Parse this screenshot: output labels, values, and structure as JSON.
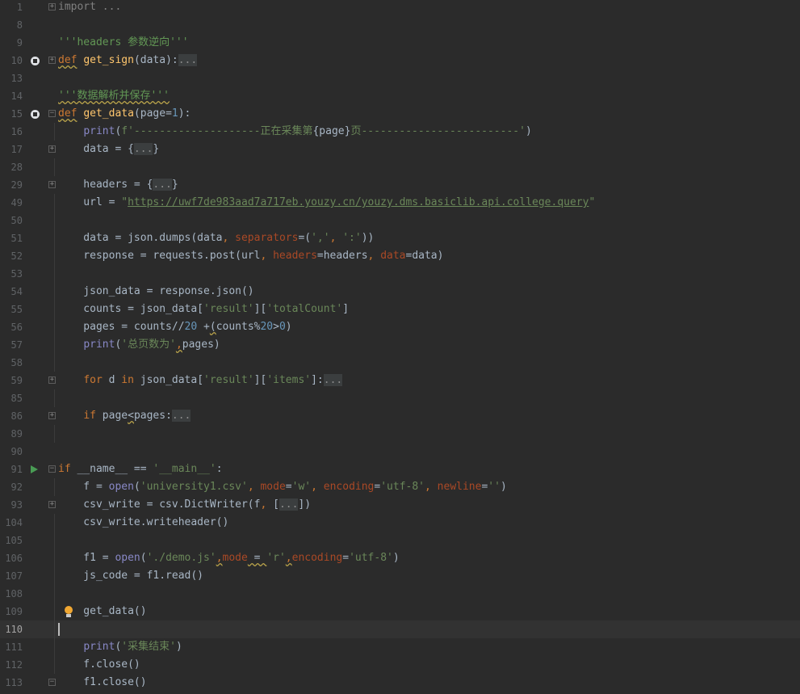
{
  "colors": {
    "background": "#2b2b2b",
    "keyword": "#cc7832",
    "function": "#ffc66d",
    "string": "#6a8759",
    "number": "#6897bb",
    "builtin": "#8888c6",
    "param": "#aa4926",
    "line_number": "#606366"
  },
  "lines": [
    {
      "n": "1",
      "tokens": [
        {
          "t": "import ...",
          "c": "cm"
        }
      ]
    },
    {
      "n": "8",
      "tokens": []
    },
    {
      "n": "9",
      "tokens": [
        {
          "t": "'''headers 参数逆向'''",
          "c": "doc"
        }
      ]
    },
    {
      "n": "10",
      "tokens": [
        {
          "t": "def",
          "c": "kw sq"
        },
        {
          "t": " "
        },
        {
          "t": "get_sign",
          "c": "fn"
        },
        {
          "t": "(data):"
        },
        {
          "t": "...",
          "c": "fd"
        }
      ]
    },
    {
      "n": "13",
      "tokens": []
    },
    {
      "n": "14",
      "tokens": [
        {
          "t": "'''数据解析并保存'''",
          "c": "doc sq"
        }
      ]
    },
    {
      "n": "15",
      "tokens": [
        {
          "t": "def",
          "c": "kw sq"
        },
        {
          "t": " "
        },
        {
          "t": "get_data",
          "c": "fn"
        },
        {
          "t": "(page="
        },
        {
          "t": "1",
          "c": "num"
        },
        {
          "t": "):"
        }
      ]
    },
    {
      "n": "16",
      "tokens": [
        {
          "t": "    "
        },
        {
          "t": "print",
          "c": "bi"
        },
        {
          "t": "("
        },
        {
          "t": "f'--------------------正在采集第",
          "c": "st"
        },
        {
          "t": "{page}"
        },
        {
          "t": "页-------------------------'",
          "c": "st"
        },
        {
          "t": ")"
        }
      ]
    },
    {
      "n": "17",
      "tokens": [
        {
          "t": "    data = {"
        },
        {
          "t": "...",
          "c": "fd"
        },
        {
          "t": "}"
        }
      ]
    },
    {
      "n": "28",
      "tokens": []
    },
    {
      "n": "29",
      "tokens": [
        {
          "t": "    headers = {"
        },
        {
          "t": "...",
          "c": "fd"
        },
        {
          "t": "}"
        }
      ]
    },
    {
      "n": "49",
      "tokens": [
        {
          "t": "    url = "
        },
        {
          "t": "\"",
          "c": "st"
        },
        {
          "t": "https://uwf7de983aad7a717eb.youzy.cn/youzy.dms.basiclib.api.college.query",
          "c": "url"
        },
        {
          "t": "\"",
          "c": "st"
        }
      ]
    },
    {
      "n": "50",
      "tokens": []
    },
    {
      "n": "51",
      "tokens": [
        {
          "t": "    data = json.dumps(data"
        },
        {
          "t": ",",
          "c": "kw"
        },
        {
          "t": " "
        },
        {
          "t": "separators",
          "c": "pm"
        },
        {
          "t": "=("
        },
        {
          "t": "','",
          "c": "st"
        },
        {
          "t": ",",
          "c": "kw"
        },
        {
          "t": " "
        },
        {
          "t": "':'",
          "c": "st"
        },
        {
          "t": "))"
        }
      ]
    },
    {
      "n": "52",
      "tokens": [
        {
          "t": "    response = requests.post(url"
        },
        {
          "t": ",",
          "c": "kw"
        },
        {
          "t": " "
        },
        {
          "t": "headers",
          "c": "pm"
        },
        {
          "t": "=headers"
        },
        {
          "t": ",",
          "c": "kw"
        },
        {
          "t": " "
        },
        {
          "t": "data",
          "c": "pm"
        },
        {
          "t": "=data)"
        }
      ]
    },
    {
      "n": "53",
      "tokens": []
    },
    {
      "n": "54",
      "tokens": [
        {
          "t": "    json_data = response.json()"
        }
      ]
    },
    {
      "n": "55",
      "tokens": [
        {
          "t": "    counts = json_data["
        },
        {
          "t": "'result'",
          "c": "st"
        },
        {
          "t": "]["
        },
        {
          "t": "'totalCount'",
          "c": "st"
        },
        {
          "t": "]"
        }
      ]
    },
    {
      "n": "56",
      "tokens": [
        {
          "t": "    pages = counts//"
        },
        {
          "t": "20",
          "c": "num"
        },
        {
          "t": " +"
        },
        {
          "t": "(",
          "c": "sq"
        },
        {
          "t": "counts%"
        },
        {
          "t": "20",
          "c": "num"
        },
        {
          "t": ">"
        },
        {
          "t": "0",
          "c": "num"
        },
        {
          "t": ")"
        }
      ]
    },
    {
      "n": "57",
      "tokens": [
        {
          "t": "    "
        },
        {
          "t": "print",
          "c": "bi"
        },
        {
          "t": "("
        },
        {
          "t": "'总页数为'",
          "c": "st"
        },
        {
          "t": ",",
          "c": "kw sq"
        },
        {
          "t": "pages)"
        }
      ]
    },
    {
      "n": "58",
      "tokens": []
    },
    {
      "n": "59",
      "tokens": [
        {
          "t": "    "
        },
        {
          "t": "for",
          "c": "kw"
        },
        {
          "t": " d "
        },
        {
          "t": "in",
          "c": "kw"
        },
        {
          "t": " json_data["
        },
        {
          "t": "'result'",
          "c": "st"
        },
        {
          "t": "]["
        },
        {
          "t": "'items'",
          "c": "st"
        },
        {
          "t": "]:"
        },
        {
          "t": "...",
          "c": "fd"
        }
      ]
    },
    {
      "n": "85",
      "tokens": []
    },
    {
      "n": "86",
      "tokens": [
        {
          "t": "    "
        },
        {
          "t": "if",
          "c": "kw"
        },
        {
          "t": " page"
        },
        {
          "t": "<",
          "c": "sq"
        },
        {
          "t": "pages:"
        },
        {
          "t": "...",
          "c": "fd"
        }
      ]
    },
    {
      "n": "89",
      "tokens": []
    },
    {
      "n": "90",
      "tokens": []
    },
    {
      "n": "91",
      "tokens": [
        {
          "t": "if",
          "c": "kw"
        },
        {
          "t": " __name__ == "
        },
        {
          "t": "'__main__'",
          "c": "st"
        },
        {
          "t": ":"
        }
      ]
    },
    {
      "n": "92",
      "tokens": [
        {
          "t": "    f = "
        },
        {
          "t": "open",
          "c": "bi"
        },
        {
          "t": "("
        },
        {
          "t": "'university1.csv'",
          "c": "st"
        },
        {
          "t": ",",
          "c": "kw"
        },
        {
          "t": " "
        },
        {
          "t": "mode",
          "c": "pm"
        },
        {
          "t": "="
        },
        {
          "t": "'w'",
          "c": "st"
        },
        {
          "t": ",",
          "c": "kw"
        },
        {
          "t": " "
        },
        {
          "t": "encoding",
          "c": "pm"
        },
        {
          "t": "="
        },
        {
          "t": "'utf-8'",
          "c": "st"
        },
        {
          "t": ",",
          "c": "kw"
        },
        {
          "t": " "
        },
        {
          "t": "newline",
          "c": "pm"
        },
        {
          "t": "="
        },
        {
          "t": "''",
          "c": "st"
        },
        {
          "t": ")"
        }
      ]
    },
    {
      "n": "93",
      "tokens": [
        {
          "t": "    csv_write = csv.DictWriter(f"
        },
        {
          "t": ",",
          "c": "kw"
        },
        {
          "t": " ["
        },
        {
          "t": "...",
          "c": "fd"
        },
        {
          "t": "])"
        }
      ]
    },
    {
      "n": "104",
      "tokens": [
        {
          "t": "    csv_write.writeheader()"
        }
      ]
    },
    {
      "n": "105",
      "tokens": []
    },
    {
      "n": "106",
      "tokens": [
        {
          "t": "    f1 = "
        },
        {
          "t": "open",
          "c": "bi"
        },
        {
          "t": "("
        },
        {
          "t": "'./demo.js'",
          "c": "st"
        },
        {
          "t": ",",
          "c": "kw sq"
        },
        {
          "t": "mode",
          "c": "pm"
        },
        {
          "t": " = ",
          "c": "sq"
        },
        {
          "t": "'r'",
          "c": "st"
        },
        {
          "t": ",",
          "c": "kw sq"
        },
        {
          "t": "encoding",
          "c": "pm"
        },
        {
          "t": "="
        },
        {
          "t": "'utf-8'",
          "c": "st"
        },
        {
          "t": ")"
        }
      ]
    },
    {
      "n": "107",
      "tokens": [
        {
          "t": "    js_code = f1.read()"
        }
      ]
    },
    {
      "n": "108",
      "tokens": []
    },
    {
      "n": "109",
      "tokens": [
        {
          "t": "    get_data()"
        }
      ]
    },
    {
      "n": "110",
      "tokens": []
    },
    {
      "n": "111",
      "tokens": [
        {
          "t": "    "
        },
        {
          "t": "print",
          "c": "bi"
        },
        {
          "t": "("
        },
        {
          "t": "'采集结束'",
          "c": "st"
        },
        {
          "t": ")"
        }
      ]
    },
    {
      "n": "112",
      "tokens": [
        {
          "t": "    f.close()"
        }
      ]
    },
    {
      "n": "113",
      "tokens": [
        {
          "t": "    f1.close()"
        }
      ]
    }
  ],
  "gutter": {
    "breakpoints": [
      "10",
      "15"
    ],
    "run_markers": [
      "91"
    ],
    "fold_markers": [
      "1",
      "10",
      "15",
      "17",
      "29",
      "59",
      "86",
      "91",
      "93",
      "113"
    ],
    "intention_bulb": "109",
    "current_line": "110"
  }
}
